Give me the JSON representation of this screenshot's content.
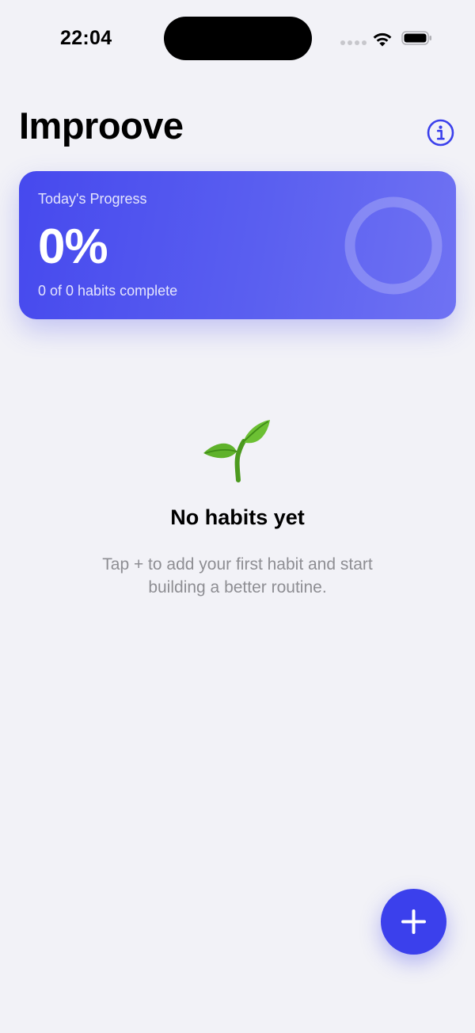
{
  "status_bar": {
    "time": "22:04"
  },
  "header": {
    "title": "Improove",
    "info_icon": "info-circle-icon"
  },
  "progress_card": {
    "label": "Today's Progress",
    "percent_text": "0%",
    "percent_value": 0,
    "count_text": "0 of 0 habits complete"
  },
  "empty_state": {
    "icon": "seedling-icon",
    "title": "No habits yet",
    "message": "Tap + to add your first habit and start building a better routine."
  },
  "fab": {
    "icon": "plus-icon"
  },
  "colors": {
    "accent": "#3b40ec",
    "background": "#f2f2f7",
    "card_gradient_start": "#4649ee",
    "card_gradient_end": "#6f72f3",
    "secondary_text": "#8e8e93"
  }
}
